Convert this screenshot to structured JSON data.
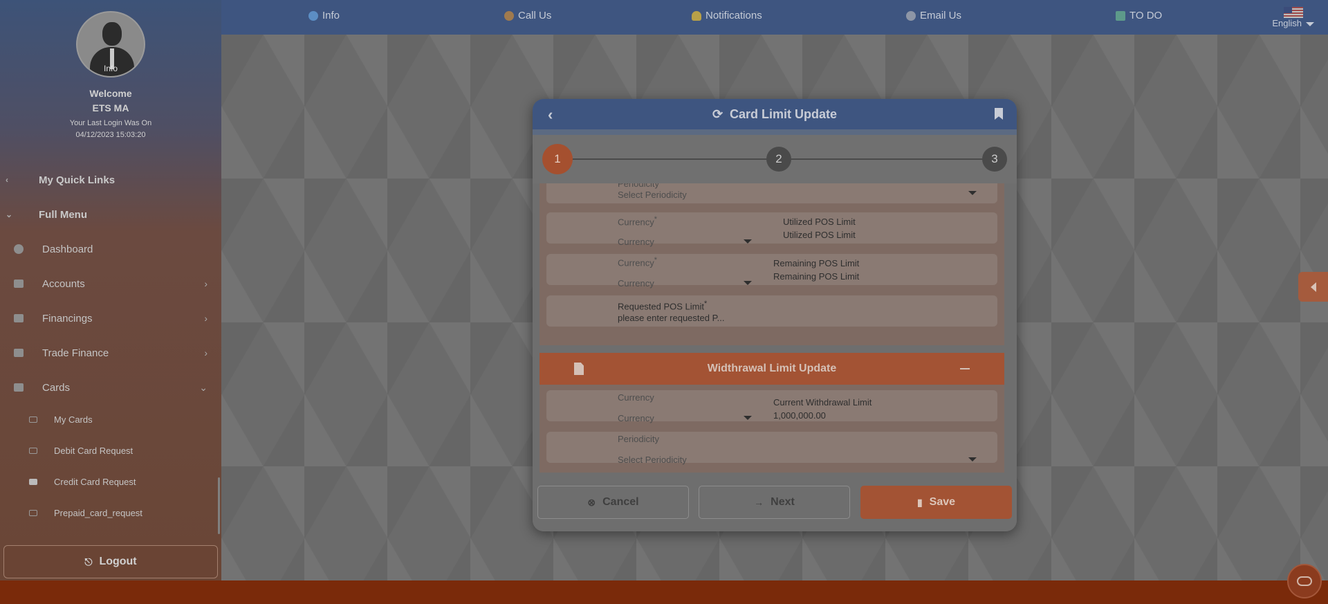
{
  "topbar": {
    "items": [
      {
        "label": "Info",
        "icon": "info-icon"
      },
      {
        "label": "Call Us",
        "icon": "person-phone-icon"
      },
      {
        "label": "Notifications",
        "icon": "bell-icon"
      },
      {
        "label": "Email Us",
        "icon": "email-icon"
      },
      {
        "label": "TO DO",
        "icon": "todo-icon"
      }
    ],
    "language": "English"
  },
  "sidebar": {
    "avatar_label": "Info",
    "welcome": "Welcome",
    "user_name": "ETS MA",
    "last_login_label": "Your Last Login Was On",
    "last_login_value": "04/12/2023 15:03:20",
    "quick_links": "My Quick Links",
    "full_menu": "Full Menu",
    "items": [
      {
        "label": "Dashboard"
      },
      {
        "label": "Accounts"
      },
      {
        "label": "Financings"
      },
      {
        "label": "Trade Finance"
      },
      {
        "label": "Cards"
      }
    ],
    "sub_items": [
      {
        "label": "My Cards"
      },
      {
        "label": "Debit Card Request"
      },
      {
        "label": "Credit Card Request"
      },
      {
        "label": "Prepaid_card_request"
      }
    ],
    "logout": "Logout"
  },
  "modal": {
    "title": "Card Limit Update",
    "steps": [
      "1",
      "2",
      "3"
    ],
    "active_step": 1,
    "pos_section": {
      "periodicity_label": "Periodicity",
      "periodicity_placeholder": "Select Periodicity",
      "currency_label": "Currency",
      "currency_placeholder": "Currency",
      "utilized_label": "Utilized POS Limit",
      "utilized_value": "Utilized POS Limit",
      "remaining_label": "Remaining POS Limit",
      "remaining_value": "Remaining POS Limit",
      "requested_label": "Requested POS Limit",
      "requested_placeholder": "please enter requested P...",
      "required_mark": "*"
    },
    "withdrawal_section": {
      "title": "Widthrawal Limit Update",
      "currency_label": "Currency",
      "currency_placeholder": "Currency",
      "current_label": "Current Withdrawal Limit",
      "current_value": "1,000,000.00",
      "periodicity_label": "Periodicity",
      "periodicity_placeholder": "Select Periodicity"
    },
    "buttons": {
      "cancel": "Cancel",
      "next": "Next",
      "save": "Save"
    }
  },
  "colors": {
    "topbar": "#3e5580",
    "accent": "#a35334",
    "bottombar": "#7a2a0a"
  }
}
